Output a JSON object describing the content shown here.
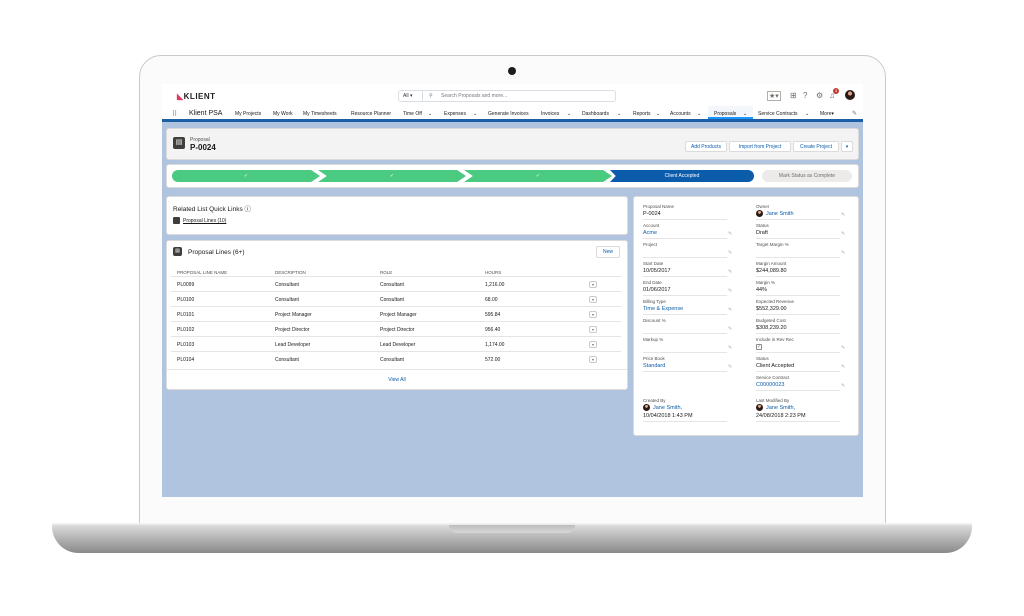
{
  "header": {
    "logo": "KLIENT",
    "search_scope": "All",
    "search_placeholder": "Search Proposals and more..."
  },
  "nav": {
    "app_name": "Klient PSA",
    "items": [
      "My Projects",
      "My Work",
      "My Timesheets",
      "Resource Planner",
      "Time Off",
      "Expenses",
      "Generate Invoices",
      "Invoices",
      "Dashboards",
      "Reports",
      "Accounts",
      "Proposals",
      "Service Contracts",
      "More"
    ],
    "active": "Proposals",
    "notification_count": "3"
  },
  "record": {
    "type": "Proposal",
    "name": "P-0024",
    "buttons": [
      "Add Products",
      "Import from Project",
      "Create Project"
    ]
  },
  "path": {
    "completed_mark": "✓",
    "current": "Client Accepted",
    "action": "Mark Status as Complete"
  },
  "quick_links": {
    "title": "Related List Quick Links",
    "link": "Proposal Lines (10)"
  },
  "lines": {
    "title": "Proposal Lines (6+)",
    "new_button": "New",
    "columns": [
      "PROPOSAL LINE NAME",
      "DESCRIPTION",
      "ROLE",
      "HOURS"
    ],
    "rows": [
      [
        "PL0099",
        "Consultant",
        "Consultant",
        "1,216.00"
      ],
      [
        "PL0100",
        "Consultant",
        "Consultant",
        "68.00"
      ],
      [
        "PL0101",
        "Project Manager",
        "Project Manager",
        "595.84"
      ],
      [
        "PL0102",
        "Project Director",
        "Project Director",
        "956.40"
      ],
      [
        "PL0103",
        "Lead Developer",
        "Lead Developer",
        "1,174.00"
      ],
      [
        "PL0104",
        "Consultant",
        "Consultant",
        "572.00"
      ]
    ],
    "view_all": "View All"
  },
  "details": {
    "left": [
      {
        "label": "Proposal Name",
        "value": "P-0024",
        "link": false
      },
      {
        "label": "Account",
        "value": "Acme",
        "link": true
      },
      {
        "label": "Project",
        "value": "",
        "link": false
      },
      {
        "label": "Start Date",
        "value": "10/05/2017",
        "link": false
      },
      {
        "label": "End Date",
        "value": "01/06/2017",
        "link": false
      },
      {
        "label": "Billing Type",
        "value": "Time & Expense",
        "link": true
      },
      {
        "label": "Discount %",
        "value": "",
        "link": false
      },
      {
        "label": "Markup %",
        "value": "",
        "link": false
      },
      {
        "label": "Price Book",
        "value": "Standard",
        "link": true
      }
    ],
    "right": [
      {
        "label": "Owner",
        "value": "Jane Smith",
        "link": true
      },
      {
        "label": "Status",
        "value": "Draft",
        "link": false
      },
      {
        "label": "Target Margin %",
        "value": "",
        "link": false
      },
      {
        "label": "Margin Amount",
        "value": "$244,089.80",
        "link": false
      },
      {
        "label": "Margin %",
        "value": "44%",
        "link": false
      },
      {
        "label": "Expected Revenue",
        "value": "$552,329.00",
        "link": false
      },
      {
        "label": "Budgeted Cost",
        "value": "$308,239.20",
        "link": false
      },
      {
        "label": "Include in Rev Rec",
        "value": "",
        "link": false
      },
      {
        "label": "Status",
        "value": "Client Accepted",
        "link": false
      },
      {
        "label": "Service Contract",
        "value": "C00000023",
        "link": true
      }
    ],
    "created_label": "Created By",
    "created_user": "Jane Smith,",
    "created_date": "10/04/2018 1:43 PM",
    "modified_label": "Last Modified By",
    "modified_user": "Jane Smith,",
    "modified_date": "24/08/2018 2:23 PM"
  }
}
